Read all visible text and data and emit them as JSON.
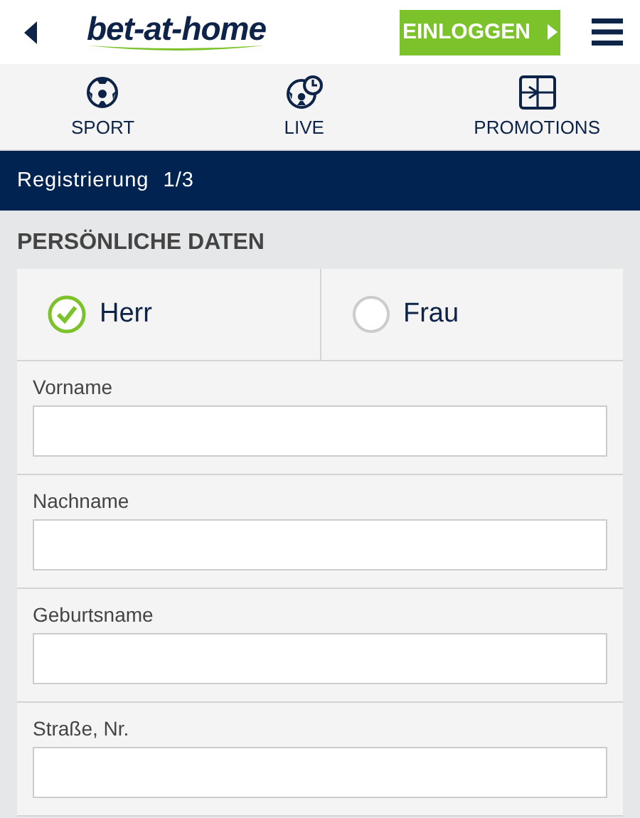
{
  "header": {
    "logo": "bet-at-home",
    "login_button": "EINLOGGEN"
  },
  "nav": [
    {
      "kind": "sport",
      "label": "SPORT"
    },
    {
      "kind": "live",
      "label": "LIVE"
    },
    {
      "kind": "promotions",
      "label": "PROMOTIONS"
    }
  ],
  "step_bar": {
    "title": "Registrierung",
    "step": "1/3"
  },
  "section_title": "PERSÖNLICHE DATEN",
  "salutation": [
    {
      "label": "Herr",
      "selected": true
    },
    {
      "label": "Frau",
      "selected": false
    }
  ],
  "fields": [
    {
      "label": "Vorname"
    },
    {
      "label": "Nachname"
    },
    {
      "label": "Geburtsname"
    },
    {
      "label": "Straße, Nr."
    }
  ]
}
